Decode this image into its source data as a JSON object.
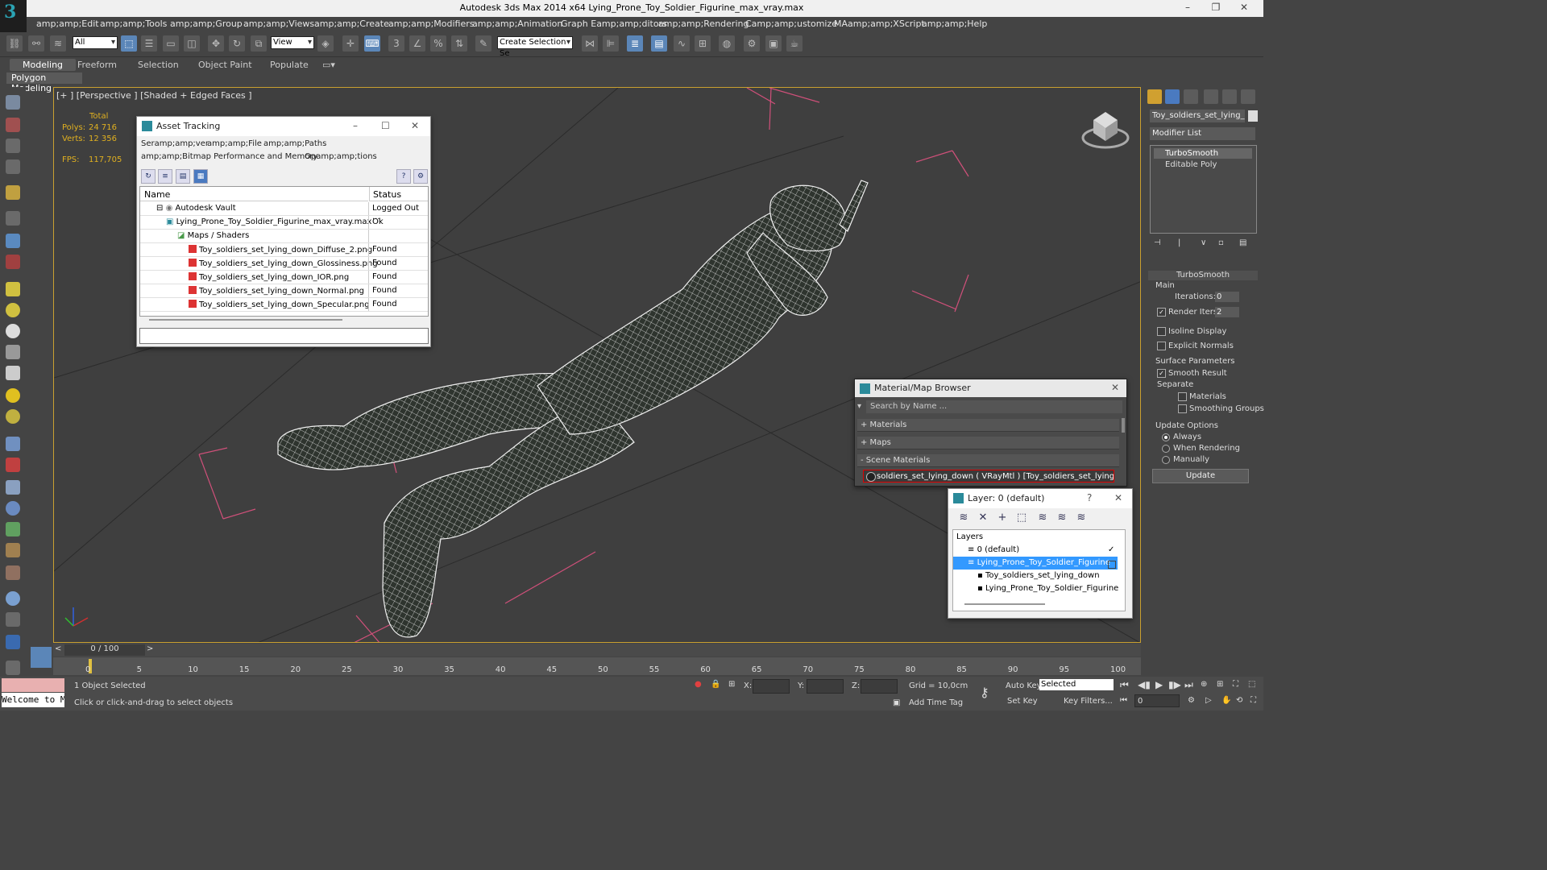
{
  "app": {
    "title": "Autodesk 3ds Max  2014 x64     Lying_Prone_Toy_Soldier_Figurine_max_vray.max"
  },
  "menu": [
    "amp;amp;Edit",
    "amp;amp;Tools",
    "amp;amp;Group",
    "amp;amp;Views",
    "amp;amp;Create",
    "amp;amp;Modifiers",
    "amp;amp;Animation",
    "Graph Eamp;amp;ditors",
    "amp;amp;Rendering",
    "Camp;amp;ustomize",
    "MAamp;amp;XScript",
    "amp;amp;Help"
  ],
  "toolbar": {
    "filter": "All",
    "refcoord": "View",
    "selection_set": "Create Selection Se"
  },
  "ribbon": {
    "tabs": [
      "Modeling",
      "Freeform",
      "Selection",
      "Object Paint",
      "Populate"
    ],
    "active": "Modeling",
    "panel": "Polygon Modeling"
  },
  "viewport": {
    "label": "[+ ] [Perspective ] [Shaded + Edged Faces ]",
    "stats": {
      "total_label": "Total",
      "polys_label": "Polys:",
      "polys": "24 716",
      "verts_label": "Verts:",
      "verts": "12 356",
      "fps_label": "FPS:",
      "fps": "117,705"
    }
  },
  "asset_tracking": {
    "title": "Asset Tracking",
    "menu": [
      "Seramp;amp;ver",
      "amp;amp;File",
      "amp;amp;Paths",
      "amp;amp;Bitmap Performance and Memory",
      "Opamp;amp;tions"
    ],
    "columns": [
      "Name",
      "Status"
    ],
    "rows": [
      {
        "name": "Autodesk Vault",
        "status": "Logged Out ..."
      },
      {
        "name": "Lying_Prone_Toy_Soldier_Figurine_max_vray.max",
        "status": "Ok"
      },
      {
        "name": "Maps / Shaders",
        "status": ""
      },
      {
        "name": "Toy_soldiers_set_lying_down_Diffuse_2.png",
        "status": "Found"
      },
      {
        "name": "Toy_soldiers_set_lying_down_Glossiness.png",
        "status": "Found"
      },
      {
        "name": "Toy_soldiers_set_lying_down_IOR.png",
        "status": "Found"
      },
      {
        "name": "Toy_soldiers_set_lying_down_Normal.png",
        "status": "Found"
      },
      {
        "name": "Toy_soldiers_set_lying_down_Specular.png",
        "status": "Found"
      }
    ]
  },
  "material_browser": {
    "title": "Material/Map Browser",
    "search_placeholder": "Search by Name ...",
    "sections": [
      "+ Materials",
      "+ Maps",
      "- Scene Materials"
    ],
    "selected": "soldiers_set_lying_down ( VRayMtl ) [Toy_soldiers_set_lying_down]"
  },
  "layer_dialog": {
    "title": "Layer: 0 (default)",
    "help": "?",
    "header": "Layers",
    "rows": [
      "0 (default)",
      "Lying_Prone_Toy_Soldier_Figurine",
      "Toy_soldiers_set_lying_down",
      "Lying_Prone_Toy_Soldier_Figurine"
    ]
  },
  "command_panel": {
    "object_name": "Toy_soldiers_set_lying_down",
    "modifier_list": "Modifier List",
    "stack": [
      "TurboSmooth",
      "Editable Poly"
    ],
    "rollout_title": "TurboSmooth",
    "main": "Main",
    "iterations_label": "Iterations:",
    "iterations": "0",
    "render_iters_label": "Render Iters:",
    "render_iters": "2",
    "isoline": "Isoline Display",
    "explicit_normals": "Explicit Normals",
    "surface_params": "Surface Parameters",
    "smooth_result": "Smooth Result",
    "separate": "Separate",
    "materials": "Materials",
    "smoothing_groups": "Smoothing Groups",
    "update_options": "Update Options",
    "always": "Always",
    "when_rendering": "When Rendering",
    "manually": "Manually",
    "update_btn": "Update"
  },
  "timeline": {
    "frame": "0 / 100",
    "ticks": [
      "0",
      "5",
      "10",
      "15",
      "20",
      "25",
      "30",
      "35",
      "40",
      "45",
      "50",
      "55",
      "60",
      "65",
      "70",
      "75",
      "80",
      "85",
      "90",
      "95",
      "100"
    ]
  },
  "status": {
    "selected": "1 Object Selected",
    "hint": "Click or click-and-drag to select objects",
    "welcome": "Welcome to M",
    "x_label": "X:",
    "y_label": "Y:",
    "z_label": "Z:",
    "grid": "Grid = 10,0cm",
    "auto_key": "Auto Key",
    "selected_drop": "Selected",
    "set_key": "Set Key",
    "key_filters": "Key Filters...",
    "add_time_tag": "Add Time Tag",
    "frame_field": "0"
  },
  "colors": {
    "accent": "#5b86b8",
    "viewport_border": "#c9a030",
    "stats": "#e0b020",
    "grid_pink": "#d0507a"
  }
}
